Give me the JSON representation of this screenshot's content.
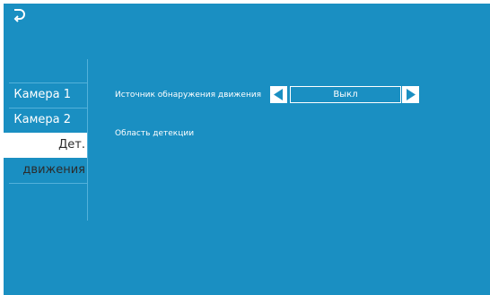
{
  "header": {
    "back_icon": "back-arrow-icon"
  },
  "sidebar": {
    "items": [
      {
        "label": "Камера 1",
        "active": false
      },
      {
        "label": "Камера 2",
        "active": false
      },
      {
        "label": "Дет. движения",
        "active": true
      }
    ]
  },
  "settings": {
    "motion_source": {
      "label": "Источник обнаружения движения",
      "value": "Выкл",
      "prev_icon": "triangle-left-icon",
      "next_icon": "triangle-right-icon"
    },
    "detection_area": {
      "label": "Область детекции"
    }
  },
  "colors": {
    "background": "#1a8fc2",
    "active_item_bg": "#ffffff",
    "text": "#ffffff"
  }
}
